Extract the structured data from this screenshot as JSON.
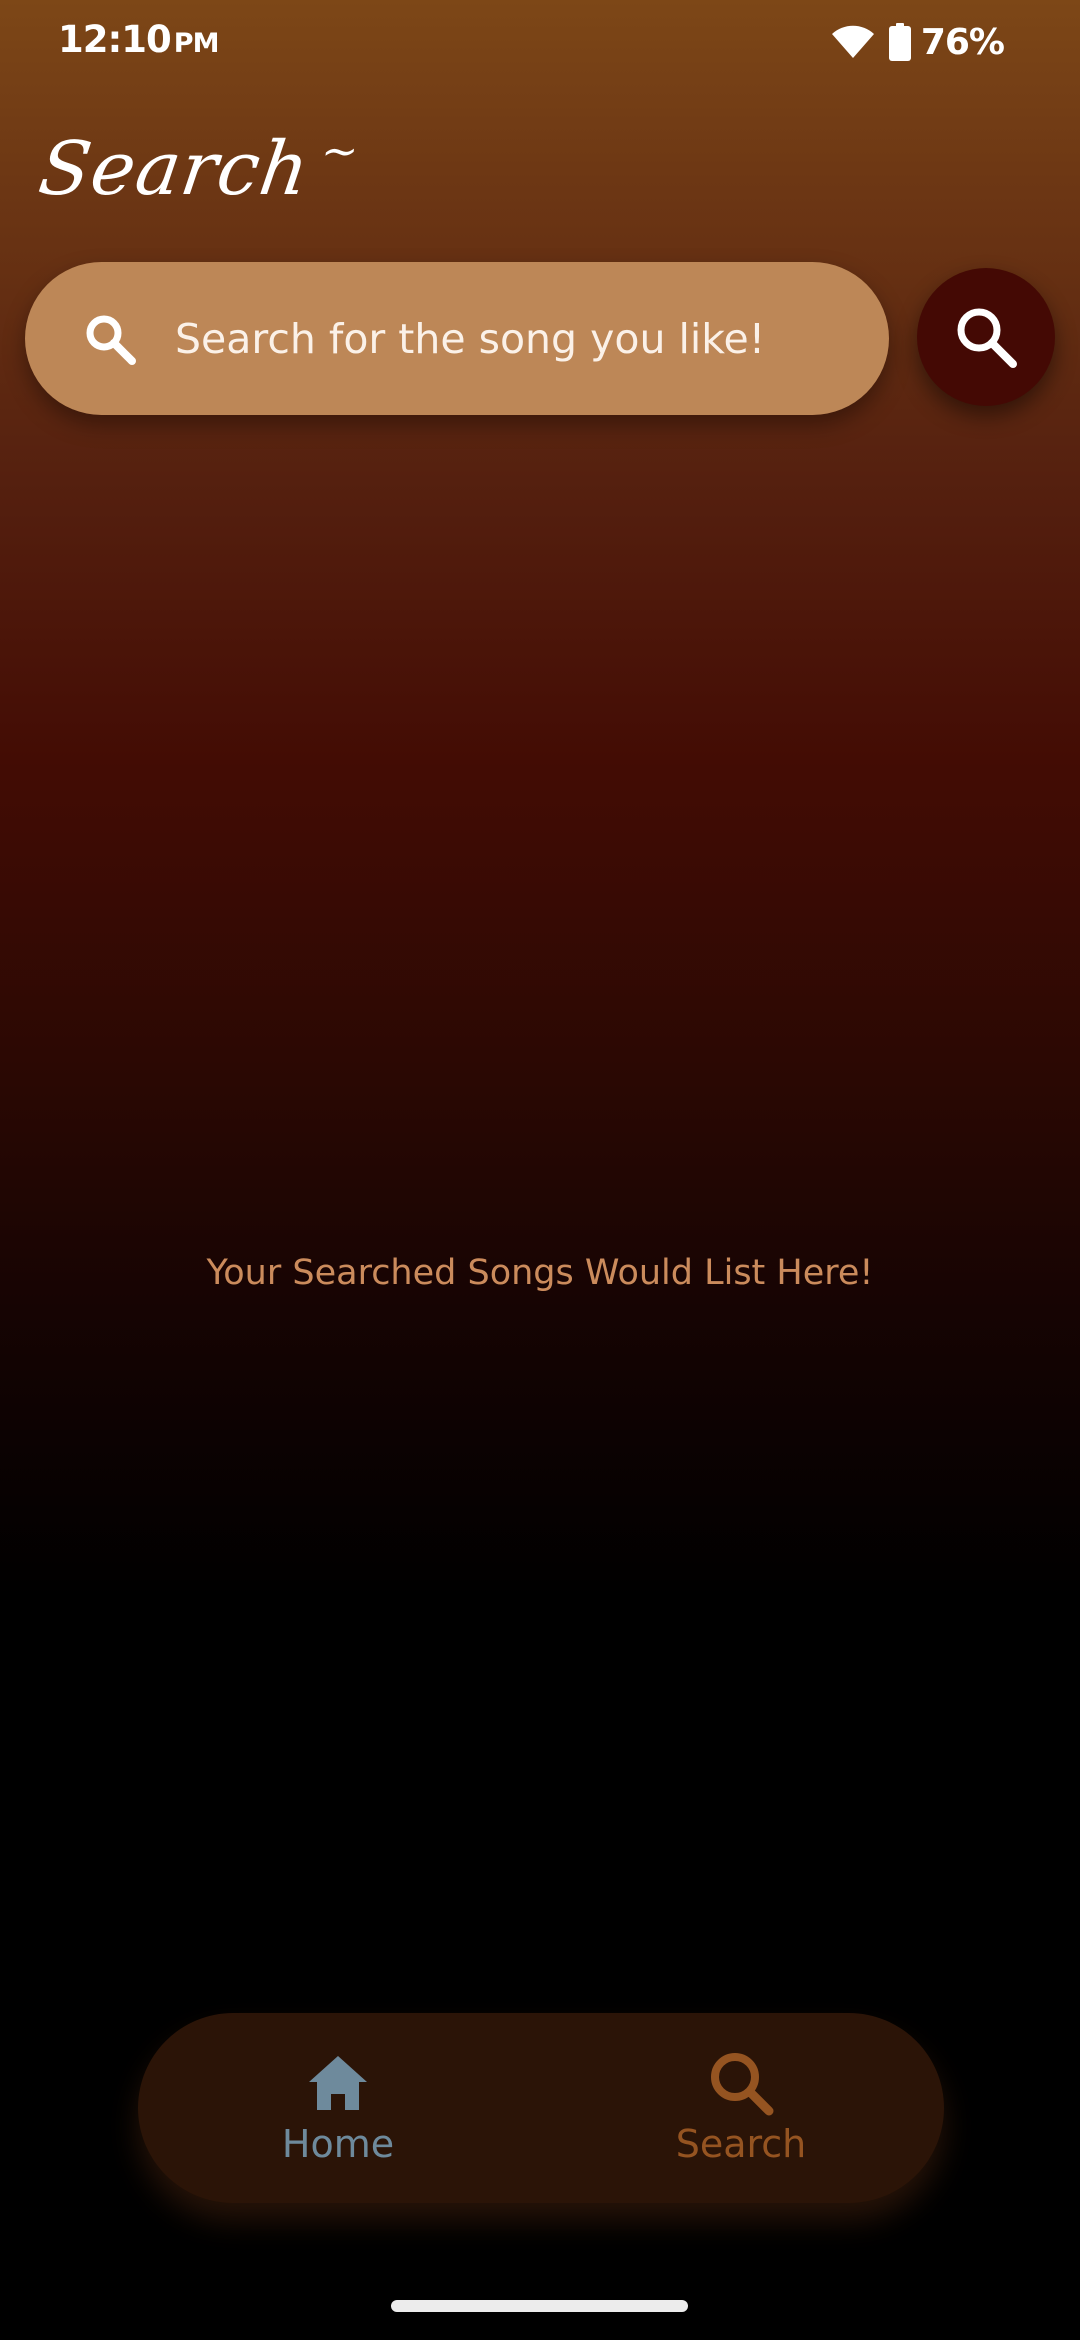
{
  "status_bar": {
    "time": "12:10",
    "ampm": "PM",
    "battery": "76%",
    "icons": [
      "wifi-icon",
      "battery-icon"
    ]
  },
  "header": {
    "title": "Search",
    "title_ornament": "~"
  },
  "search": {
    "placeholder": "Search for the song you like!",
    "value": "",
    "field_icon": "search-icon",
    "button_icon": "search-icon"
  },
  "main": {
    "empty_message": "Your Searched Songs Would List Here!"
  },
  "bottom_nav": {
    "items": [
      {
        "label": "Home",
        "icon": "home-icon",
        "active": false
      },
      {
        "label": "Search",
        "icon": "search-icon",
        "active": true
      }
    ]
  },
  "colors": {
    "search_bar_bg": "#bd8757",
    "search_button_bg": "#440904",
    "empty_message": "#cb8b5c",
    "nav_bg": "#2b1407",
    "nav_inactive": "#6e8a9c",
    "nav_active": "#955421"
  }
}
